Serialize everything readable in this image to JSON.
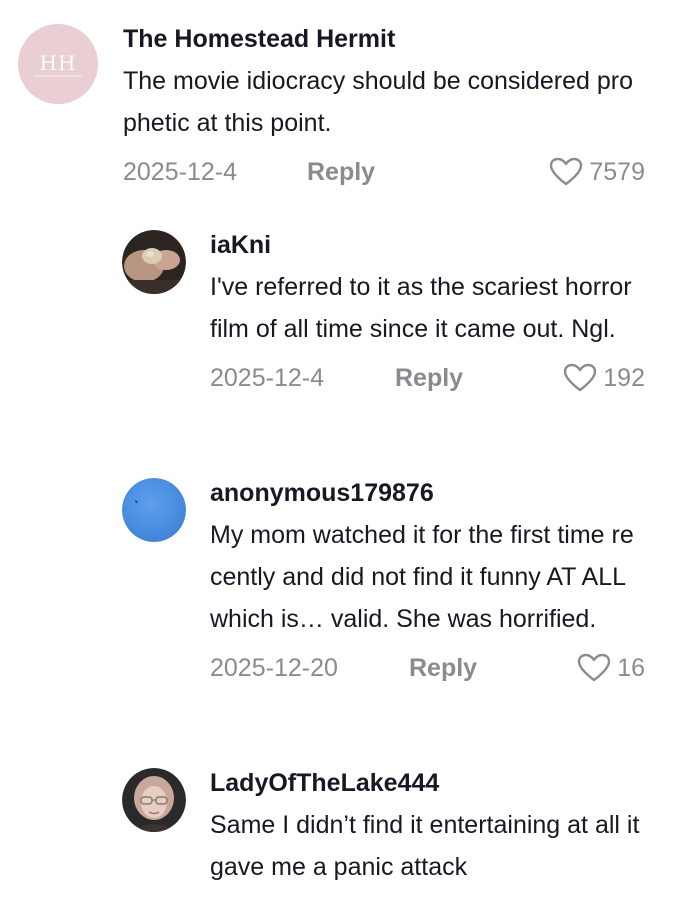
{
  "comments": [
    {
      "username": "The Homestead Hermit",
      "text": "The movie idiocracy should be considered prophetic at this point.",
      "date": "2025-12-4",
      "reply_label": "Reply",
      "likes": "7579",
      "avatar_icon": "homestead-hermit-logo",
      "avatar_text": "HH"
    },
    {
      "username": "iaKni",
      "text": "I've referred to it as the scariest horror film of all time since it came out. Ngl.",
      "date": "2025-12-4",
      "reply_label": "Reply",
      "likes": "192",
      "avatar_icon": "hand-photo-avatar"
    },
    {
      "username": "anonymous179876",
      "text": "My mom watched it for the first time recently and did not find it funny AT ALL which is… valid. She was horrified.",
      "date": "2025-12-20",
      "reply_label": "Reply",
      "likes": "16",
      "avatar_icon": "blue-sky-avatar"
    },
    {
      "username": "LadyOfTheLake444",
      "text": "Same I didn’t find it entertaining at all it gave me a panic attack",
      "avatar_icon": "woman-portrait-avatar"
    }
  ],
  "colors": {
    "secondary_text": "#8a8b91",
    "primary_text": "#161823",
    "hermit_avatar_bg": "#e9cfd3",
    "anon_avatar_bg": "#4a8fe0"
  }
}
